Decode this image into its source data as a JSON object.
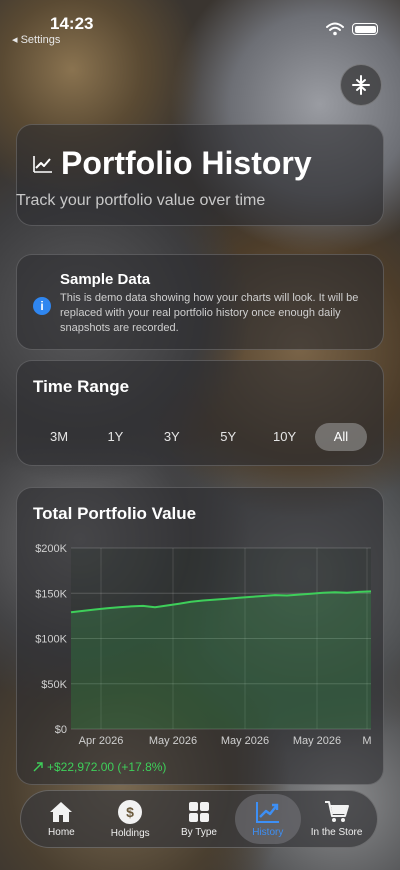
{
  "status_bar": {
    "time": "14:23",
    "back_label": "◂ Settings"
  },
  "header": {
    "title": "Portfolio History",
    "subtitle": "Track your portfolio value over time"
  },
  "sample_notice": {
    "title": "Sample Data",
    "text": "This is demo data showing how your charts will look. It will be replaced with your real portfolio history once enough daily snapshots are recorded."
  },
  "time_range": {
    "title": "Time Range",
    "options": [
      "3M",
      "1Y",
      "3Y",
      "5Y",
      "10Y",
      "All"
    ],
    "selected": "All"
  },
  "chart_card": {
    "title": "Total Portfolio Value",
    "change_text": "+$22,972.00 (+17.8%)"
  },
  "chart_data": {
    "type": "area",
    "title": "Total Portfolio Value",
    "y_ticks": [
      "$200K",
      "$150K",
      "$100K",
      "$50K",
      "$0"
    ],
    "x_ticks": [
      "Apr 2026",
      "May 2026",
      "May 2026",
      "May 2026",
      "M"
    ],
    "ylim": [
      0,
      200000
    ],
    "grid": true,
    "line_color": "#3ecf5a",
    "series": [
      {
        "values": [
          129000,
          130500,
          132000,
          133500,
          134500,
          135500,
          136000,
          134500,
          136500,
          138500,
          140500,
          142000,
          143000,
          144000,
          145000,
          146000,
          147000,
          148000,
          147500,
          148500,
          149500,
          150500,
          151000,
          150500,
          151500,
          152000
        ]
      }
    ]
  },
  "tabbar": {
    "items": [
      {
        "label": "Home",
        "icon": "house-icon"
      },
      {
        "label": "Holdings",
        "icon": "dollar-coin-icon"
      },
      {
        "label": "By Type",
        "icon": "grid-icon"
      },
      {
        "label": "History",
        "icon": "chart-icon"
      },
      {
        "label": "In the Store",
        "icon": "cart-icon"
      }
    ],
    "active": "History",
    "active_color": "#3d8ff5"
  }
}
